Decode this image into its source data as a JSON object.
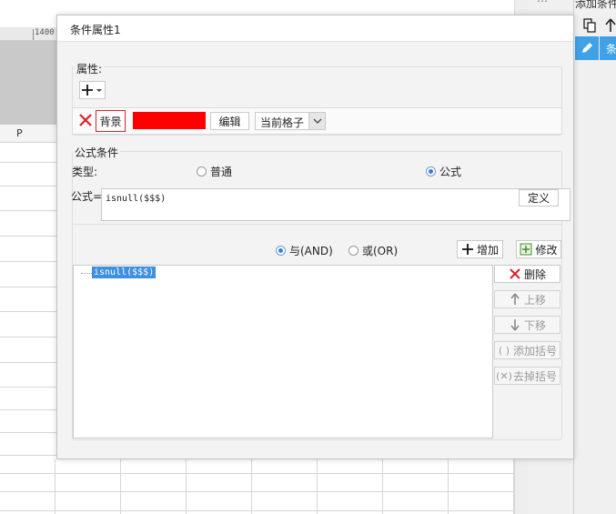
{
  "dialog": {
    "title": "条件属性1",
    "attributes": {
      "label": "属性:",
      "background_label": "背景",
      "background_color": "#ff0000",
      "edit_label": "编辑",
      "scope_value": "当前格子"
    },
    "formula_condition": {
      "label": "公式条件",
      "type_label": "类型:",
      "type_options": [
        "普通",
        "公式"
      ],
      "type_selected": "公式",
      "formula_label": "公式=",
      "formula_value": "isnull($$$)",
      "define_label": "定义",
      "and_label": "与(AND)",
      "or_label": "或(OR)",
      "logic_selected": "与(AND)",
      "add_label": "增加",
      "modify_label": "修改",
      "conditions": [
        "isnull($$$)"
      ],
      "delete_label": "删除",
      "move_up_label": "上移",
      "move_down_label": "下移",
      "add_bracket_label": "添加括号",
      "remove_bracket_label": "去掉括号"
    }
  },
  "sheet": {
    "ruler_label": "1400",
    "column_label": "P"
  },
  "side_panel": {
    "title": "添加条件",
    "item_label": "条"
  },
  "colors": {
    "accent": "#3fa1e6",
    "background_swatch": "#ff0000",
    "selection": "#3d8fe0",
    "delete_red": "#d9232b"
  }
}
